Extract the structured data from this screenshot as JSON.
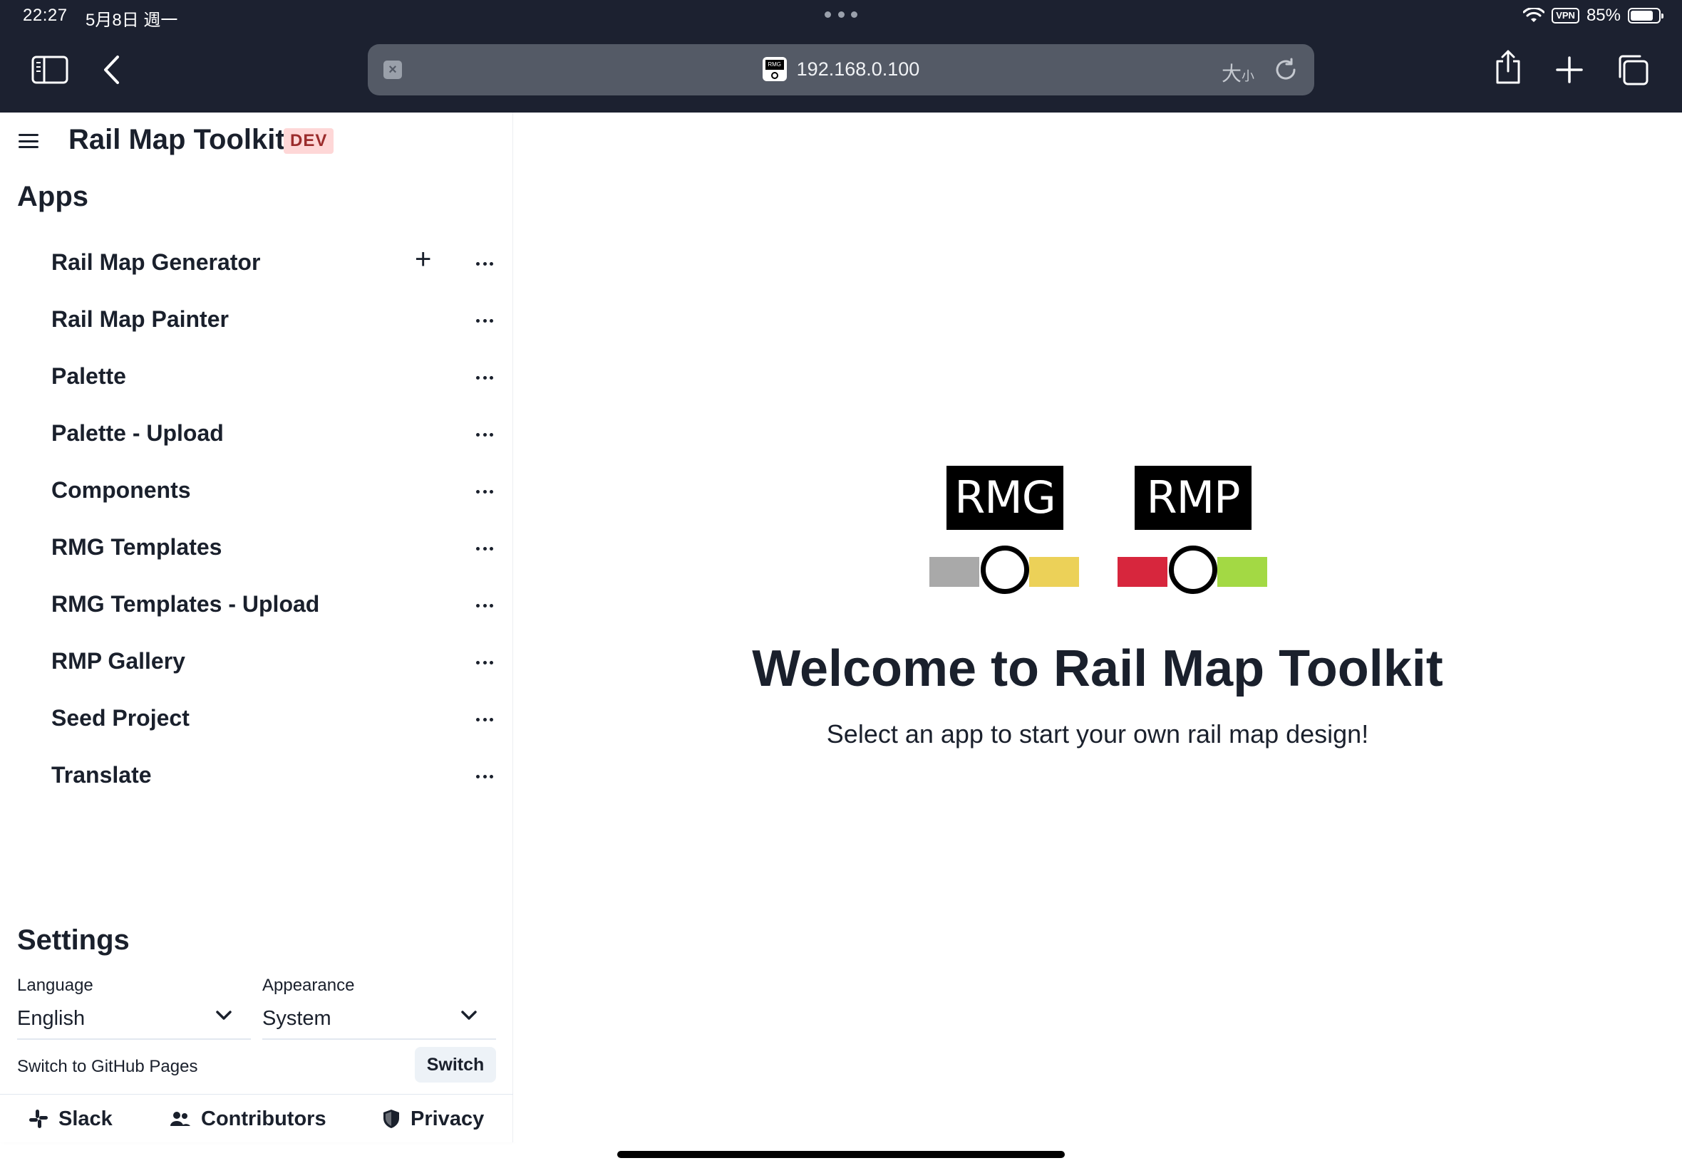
{
  "status_bar": {
    "time": "22:27",
    "date": "5月8日 週一",
    "vpn": "VPN",
    "battery": "85%"
  },
  "browser": {
    "url": "192.168.0.100",
    "text_size_label_big": "大",
    "text_size_label_small": "小",
    "favicon_text": "RMG"
  },
  "sidebar": {
    "title": "Rail Map Toolkit",
    "badge": "DEV",
    "apps_heading": "Apps",
    "apps": [
      {
        "label": "Rail Map Generator",
        "has_add": true
      },
      {
        "label": "Rail Map Painter",
        "has_add": false
      },
      {
        "label": "Palette",
        "has_add": false
      },
      {
        "label": "Palette - Upload",
        "has_add": false
      },
      {
        "label": "Components",
        "has_add": false
      },
      {
        "label": "RMG Templates",
        "has_add": false
      },
      {
        "label": "RMG Templates - Upload",
        "has_add": false
      },
      {
        "label": "RMP Gallery",
        "has_add": false
      },
      {
        "label": "Seed Project",
        "has_add": false
      },
      {
        "label": "Translate",
        "has_add": false
      }
    ],
    "settings_heading": "Settings",
    "language_label": "Language",
    "language_value": "English",
    "appearance_label": "Appearance",
    "appearance_value": "System",
    "github_label": "Switch to GitHub Pages",
    "switch_button": "Switch",
    "footer": {
      "slack": "Slack",
      "contributors": "Contributors",
      "privacy": "Privacy"
    }
  },
  "main": {
    "logo_rmg": "RMG",
    "logo_rmp": "RMP",
    "welcome": "Welcome to Rail Map Toolkit",
    "subtitle": "Select an app to start your own rail map design!"
  },
  "colors": {
    "chrome_bg": "#1c2130",
    "rmg_left": "#a9a9a9",
    "rmg_right": "#ecd158",
    "rmp_left": "#d7263d",
    "rmp_right": "#a3d944",
    "dev_badge_bg": "#fed7d7",
    "dev_badge_fg": "#9b2c2c"
  }
}
